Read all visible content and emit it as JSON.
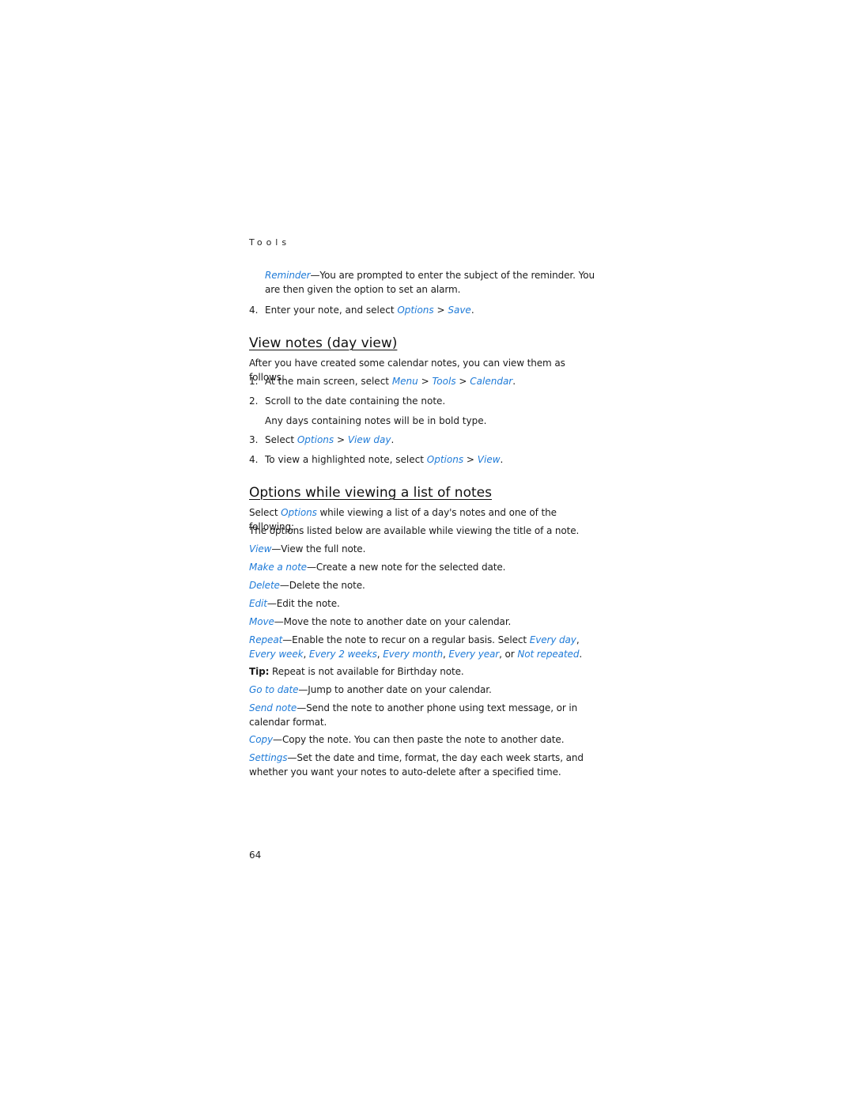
{
  "running_head": "Tools",
  "intro": {
    "reminder": {
      "term": "Reminder",
      "text": "—You are prompted to enter the subject of the reminder. You are then given the option to set an alarm."
    },
    "step4": {
      "num": "4.",
      "pre": "Enter your note, and select ",
      "link1": "Options",
      "sep": " > ",
      "link2": "Save",
      "post": "."
    }
  },
  "section1": {
    "title": "View notes (day view)",
    "intro": "After you have created some calendar notes, you can view them as follows:",
    "steps": [
      {
        "num": "1.",
        "pre": "At the main screen, select ",
        "link1": "Menu",
        "sep1": " > ",
        "link2": "Tools",
        "sep2": " > ",
        "link3": "Calendar",
        "post": "."
      },
      {
        "num": "2.",
        "text": "Scroll to the date containing the note.",
        "sub": "Any days containing notes will be in bold type."
      },
      {
        "num": "3.",
        "pre": "Select ",
        "link1": "Options",
        "sep": " > ",
        "link2": "View day",
        "post": "."
      },
      {
        "num": "4.",
        "pre": "To view a highlighted note, select ",
        "link1": "Options",
        "sep": " > ",
        "link2": "View",
        "post": "."
      }
    ]
  },
  "section2": {
    "title": "Options while viewing a list of notes",
    "intro_pre": "Select ",
    "intro_link": "Options",
    "intro_post": " while viewing a list of a day's notes and one of the following:",
    "note": "The options listed below are available while viewing the title of a note.",
    "options": [
      {
        "term": "View",
        "text": "—View the full note."
      },
      {
        "term": "Make a note",
        "text": "—Create a new note for the selected date."
      },
      {
        "term": "Delete",
        "text": "—Delete the note."
      },
      {
        "term": "Edit",
        "text": "—Edit the note."
      },
      {
        "term": "Move",
        "text": "—Move the note to another date on your calendar."
      }
    ],
    "repeat": {
      "term": "Repeat",
      "text": "—Enable the note to recur on a regular basis. Select ",
      "choices": [
        "Every day",
        "Every week",
        "Every 2 weeks",
        "Every month",
        "Every year",
        "Not repeated"
      ],
      "c1": ", ",
      "c_or": ", or ",
      "end": "."
    },
    "tip": {
      "label": "Tip:",
      "text": " Repeat is not available for Birthday note."
    },
    "options2": [
      {
        "term": "Go to date",
        "text": "—Jump to another date on your calendar."
      },
      {
        "term": "Send note",
        "text": "—Send the note to another phone using text message, or in calendar format."
      },
      {
        "term": "Copy",
        "text": "—Copy the note. You can then paste the note to another date."
      },
      {
        "term": "Settings",
        "text": "—Set the date and time, format, the day each week starts, and whether you want your notes to auto-delete after a specified time."
      }
    ]
  },
  "page_number": "64",
  "colors": {
    "link": "#1f7bd8",
    "text": "#1a1a1a"
  }
}
